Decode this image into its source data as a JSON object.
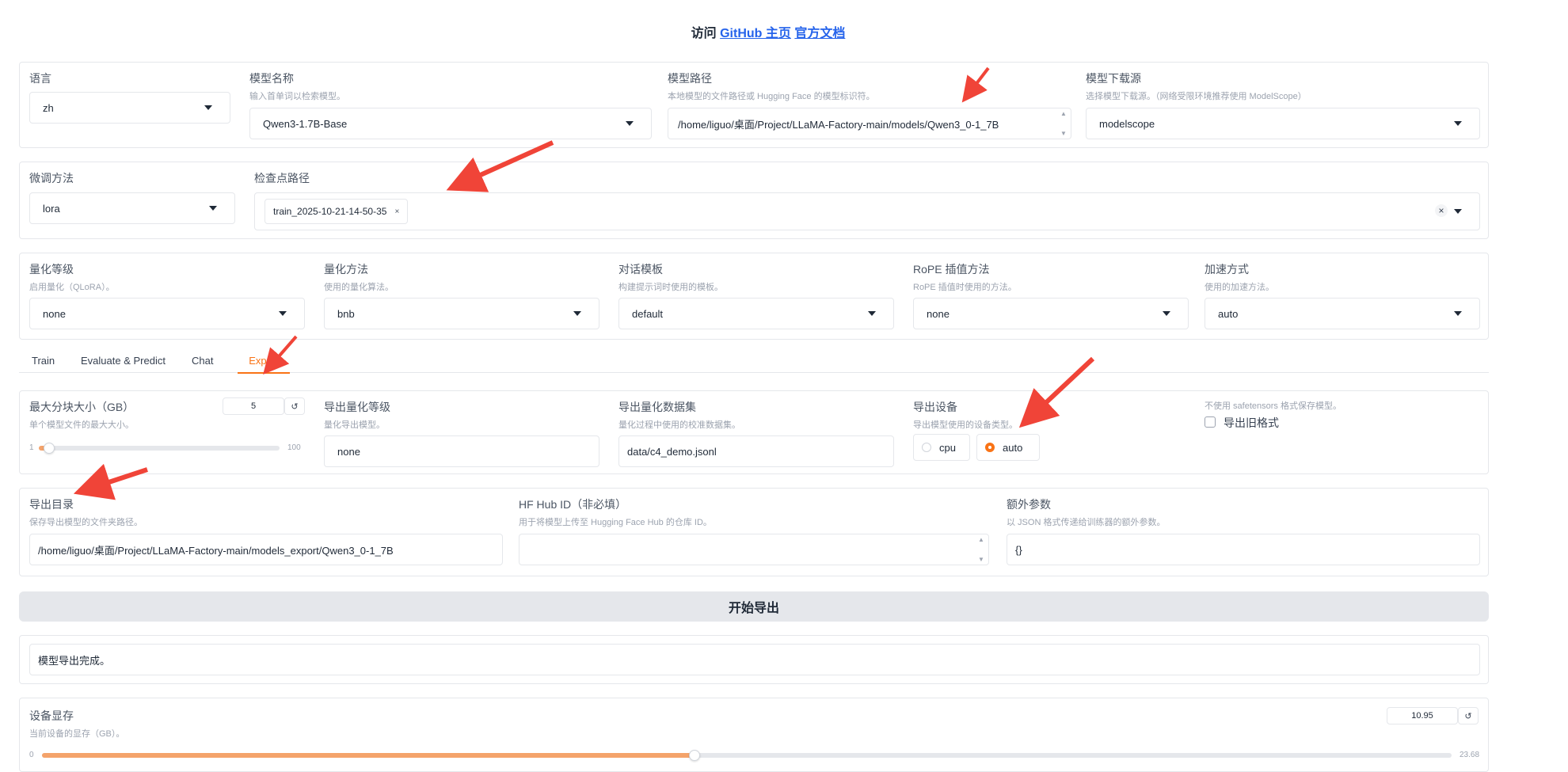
{
  "header": {
    "prefix": "访问",
    "link_github": "GitHub 主页",
    "link_docs": "官方文档"
  },
  "row1": {
    "lang": {
      "label": "语言",
      "value": "zh"
    },
    "model_name": {
      "label": "模型名称",
      "info": "输入首单词以检索模型。",
      "value": "Qwen3-1.7B-Base"
    },
    "model_path": {
      "label": "模型路径",
      "info": "本地模型的文件路径或 Hugging Face 的模型标识符。",
      "value": "/home/liguo/桌面/Project/LLaMA-Factory-main/models/Qwen3_0-1_7B"
    },
    "hub": {
      "label": "模型下载源",
      "info": "选择模型下载源。（网络受限环境推荐使用 ModelScope）",
      "value": "modelscope"
    }
  },
  "row2": {
    "finetune": {
      "label": "微调方法",
      "value": "lora"
    },
    "checkpoint": {
      "label": "检查点路径",
      "chip": "train_2025-10-21-14-50-35",
      "chip_remove": "×",
      "clear": "×"
    }
  },
  "row3": {
    "quant_bit": {
      "label": "量化等级",
      "info": "启用量化（QLoRA）。",
      "value": "none"
    },
    "quant_method": {
      "label": "量化方法",
      "info": "使用的量化算法。",
      "value": "bnb"
    },
    "template": {
      "label": "对话模板",
      "info": "构建提示词时使用的模板。",
      "value": "default"
    },
    "rope": {
      "label": "RoPE 插值方法",
      "info": "RoPE 插值时使用的方法。",
      "value": "none"
    },
    "booster": {
      "label": "加速方式",
      "info": "使用的加速方法。",
      "value": "auto"
    }
  },
  "tabs": [
    "Train",
    "Evaluate & Predict",
    "Chat",
    "Export"
  ],
  "active_tab": "Export",
  "export": {
    "shard": {
      "label": "最大分块大小（GB）",
      "info": "单个模型文件的最大大小。",
      "value": "5",
      "reset": "↺",
      "min": "1",
      "max": "100",
      "level": 0.04
    },
    "quant_bit": {
      "label": "导出量化等级",
      "info": "量化导出模型。",
      "value": "none"
    },
    "dataset": {
      "label": "导出量化数据集",
      "info": "量化过程中使用的校准数据集。",
      "value": "data/c4_demo.jsonl"
    },
    "device": {
      "label": "导出设备",
      "info": "导出模型使用的设备类型。",
      "options": [
        "cpu",
        "auto"
      ],
      "selected": "auto"
    },
    "legacy": {
      "info": "不使用 safetensors 格式保存模型。",
      "label": "导出旧格式"
    },
    "dir": {
      "label": "导出目录",
      "info": "保存导出模型的文件夹路径。",
      "value": "/home/liguo/桌面/Project/LLaMA-Factory-main/models_export/Qwen3_0-1_7B"
    },
    "hub_id": {
      "label": "HF Hub ID（非必填）",
      "info": "用于将模型上传至 Hugging Face Hub 的仓库 ID。",
      "value": ""
    },
    "extra": {
      "label": "额外参数",
      "info": "以 JSON 格式传递给训练器的额外参数。",
      "value": "{}"
    },
    "start_button": "开始导出",
    "output": "模型导出完成。"
  },
  "memory": {
    "label": "设备显存",
    "info": "当前设备的显存（GB）。",
    "value": "10.95",
    "reset": "↺",
    "min": "0",
    "max": "23.68",
    "level": 0.4624
  },
  "colors": {
    "accent": "#f97316",
    "link": "#2563eb",
    "arrow": "#f04438"
  }
}
